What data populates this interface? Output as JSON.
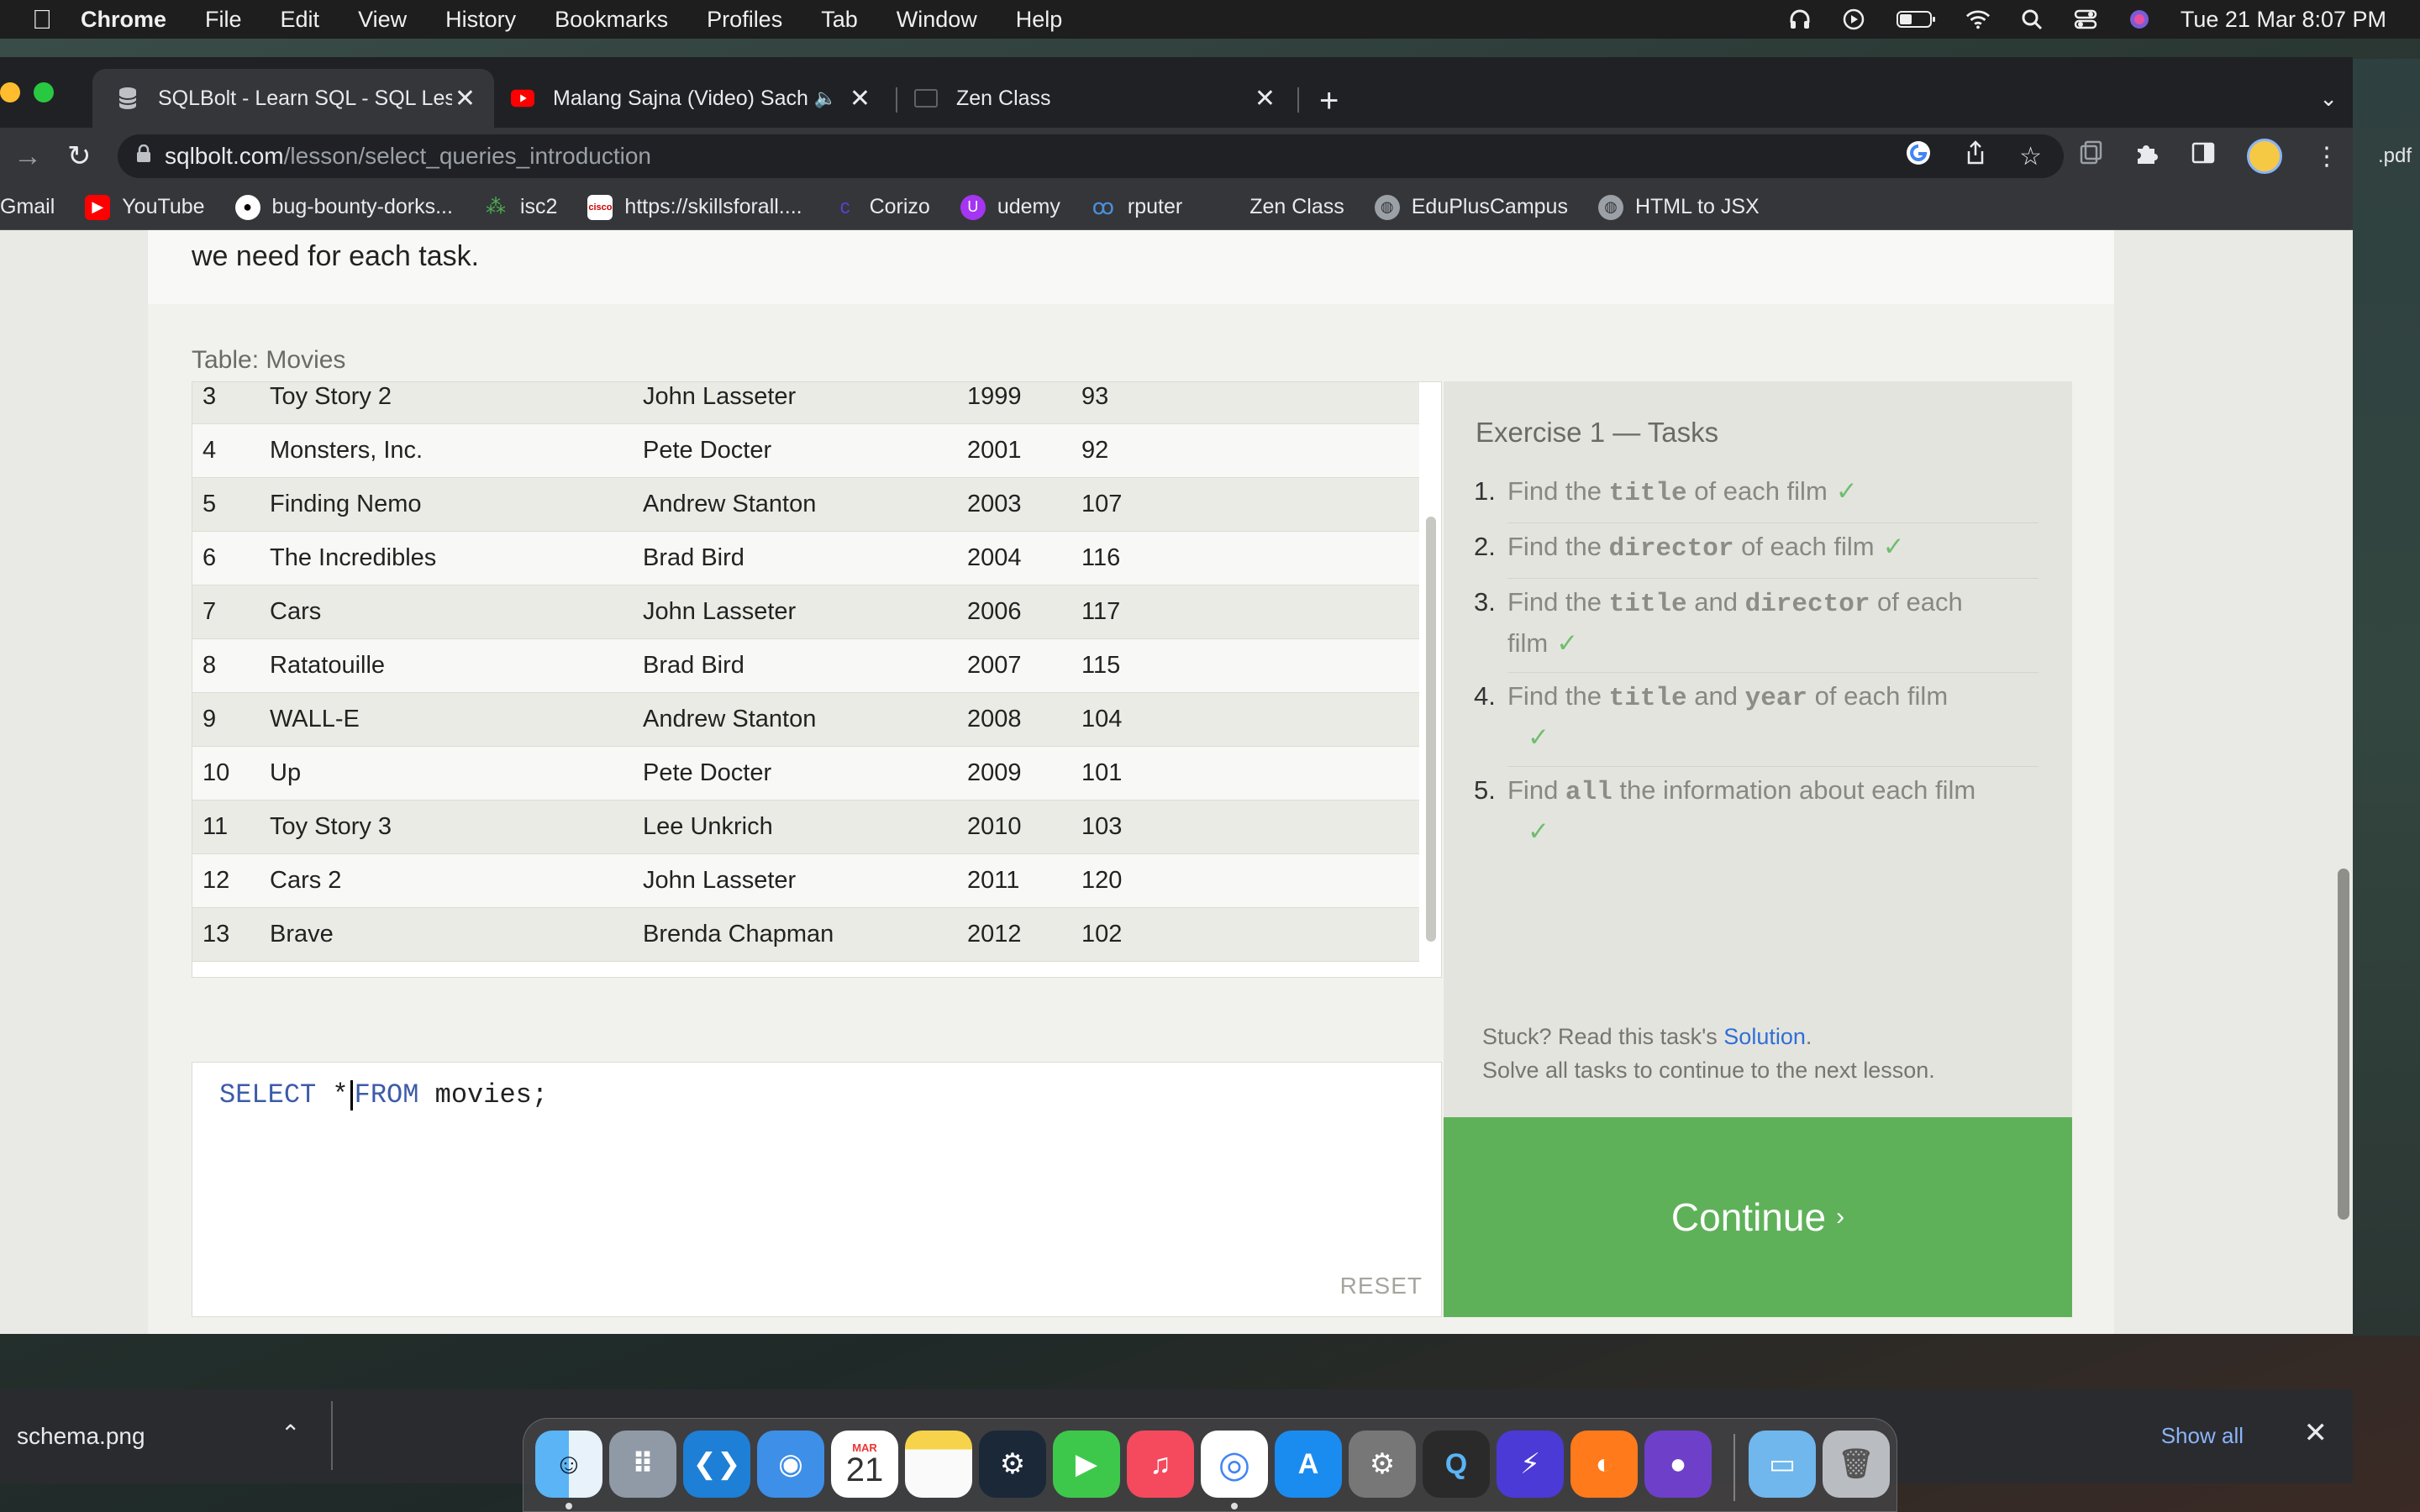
{
  "menubar": {
    "app": "Chrome",
    "items": [
      "File",
      "Edit",
      "View",
      "History",
      "Bookmarks",
      "Profiles",
      "Tab",
      "Window",
      "Help"
    ],
    "datetime": "Tue 21 Mar  8:07 PM"
  },
  "tabs": [
    {
      "title": "SQLBolt - Learn SQL - SQL Les",
      "icon": "database-icon",
      "active": true
    },
    {
      "title": "Malang Sajna (Video) Sach",
      "icon": "youtube-icon",
      "active": false
    },
    {
      "title": "Zen Class",
      "icon": "page-icon",
      "active": false
    }
  ],
  "address": {
    "host": "sqlbolt.com",
    "path": "/lesson/select_queries_introduction"
  },
  "bookmarks": [
    {
      "label": "Gmail",
      "icon": "gmail-icon",
      "color": "#ea4335"
    },
    {
      "label": "YouTube",
      "icon": "youtube-icon",
      "color": "#ff0000"
    },
    {
      "label": "bug-bounty-dorks...",
      "icon": "github-icon",
      "color": "#ffffff"
    },
    {
      "label": "isc2",
      "icon": "isc2-icon",
      "color": "#4caf50"
    },
    {
      "label": "https://skillsforall....",
      "icon": "cisco-icon",
      "color": "#ffffff"
    },
    {
      "label": "Corizo",
      "icon": "corizo-icon",
      "color": "#5b3fd6"
    },
    {
      "label": "udemy",
      "icon": "udemy-icon",
      "color": "#a435f0"
    },
    {
      "label": "rputer",
      "icon": "rputer-icon",
      "color": "#4a90d9"
    },
    {
      "label": "Zen Class",
      "icon": "zen-icon",
      "color": "#333333"
    },
    {
      "label": "EduPlusCampus",
      "icon": "globe-icon",
      "color": "#9aa0a6"
    },
    {
      "label": "HTML to JSX",
      "icon": "globe-icon",
      "color": "#9aa0a6"
    }
  ],
  "lesson": {
    "intro_tail": "we need for each task.",
    "table_caption": "Table: Movies",
    "rows": [
      {
        "id": "3",
        "title": "Toy Story 2",
        "director": "John Lasseter",
        "year": "1999",
        "length": "93"
      },
      {
        "id": "4",
        "title": "Monsters, Inc.",
        "director": "Pete Docter",
        "year": "2001",
        "length": "92"
      },
      {
        "id": "5",
        "title": "Finding Nemo",
        "director": "Andrew Stanton",
        "year": "2003",
        "length": "107"
      },
      {
        "id": "6",
        "title": "The Incredibles",
        "director": "Brad Bird",
        "year": "2004",
        "length": "116"
      },
      {
        "id": "7",
        "title": "Cars",
        "director": "John Lasseter",
        "year": "2006",
        "length": "117"
      },
      {
        "id": "8",
        "title": "Ratatouille",
        "director": "Brad Bird",
        "year": "2007",
        "length": "115"
      },
      {
        "id": "9",
        "title": "WALL-E",
        "director": "Andrew Stanton",
        "year": "2008",
        "length": "104"
      },
      {
        "id": "10",
        "title": "Up",
        "director": "Pete Docter",
        "year": "2009",
        "length": "101"
      },
      {
        "id": "11",
        "title": "Toy Story 3",
        "director": "Lee Unkrich",
        "year": "2010",
        "length": "103"
      },
      {
        "id": "12",
        "title": "Cars 2",
        "director": "John Lasseter",
        "year": "2011",
        "length": "120"
      },
      {
        "id": "13",
        "title": "Brave",
        "director": "Brenda Chapman",
        "year": "2012",
        "length": "102"
      }
    ],
    "editor": {
      "kw1": "SELECT",
      "star": "*",
      "kw2": "FROM",
      "rest": "movies;"
    },
    "reset_label": "RESET"
  },
  "exercise": {
    "title": "Exercise 1 — Tasks",
    "tasks": [
      {
        "num": "1.",
        "parts": [
          "Find the ",
          "title",
          " of each film"
        ],
        "check": "✓"
      },
      {
        "num": "2.",
        "parts": [
          "Find the ",
          "director",
          " of each film"
        ],
        "check": "✓"
      },
      {
        "num": "3.",
        "parts": [
          "Find the ",
          "title",
          " and ",
          "director",
          " of each film"
        ],
        "check": "✓"
      },
      {
        "num": "4.",
        "parts": [
          "Find the ",
          "title",
          " and ",
          "year",
          " of each film"
        ],
        "check": "✓"
      },
      {
        "num": "5.",
        "parts": [
          "Find ",
          "all",
          " the information about each film"
        ],
        "check": "✓"
      }
    ],
    "stuck_prefix": "Stuck? Read this task's ",
    "solution_link": "Solution",
    "stuck_suffix": ".",
    "solve_all": "Solve all tasks to continue to the next lesson.",
    "continue_label": "Continue",
    "continue_color": "#5fb159"
  },
  "download": {
    "file": "schema.png",
    "show_all": "Show all"
  },
  "desktop": {
    "right_file": ".pdf"
  },
  "dock": {
    "calendar_month": "MAR",
    "calendar_day": "21",
    "apps": [
      "finder-icon",
      "launchpad-icon",
      "vscode-icon",
      "safari-icon",
      "calendar-icon",
      "notes-icon",
      "steam-icon",
      "facetime-icon",
      "music-icon",
      "chrome-icon",
      "appstore-icon",
      "settings-icon",
      "quicktime-icon",
      "shortcut-icon",
      "firefox-icon",
      "github-icon",
      "folder-icon",
      "trash-icon"
    ]
  }
}
